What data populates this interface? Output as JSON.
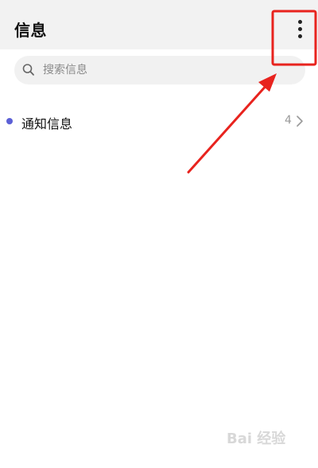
{
  "header": {
    "title": "信息",
    "more_icon": "more-vertical-icon"
  },
  "search": {
    "placeholder": "搜索信息",
    "icon": "search-icon"
  },
  "messages": [
    {
      "label": "通知信息",
      "count": "4",
      "unread": true
    }
  ],
  "annotation": {
    "color": "#e8231e"
  },
  "watermark": {
    "text": "Bai 经验"
  },
  "colors": {
    "header_bg": "#f2f2f2",
    "unread_dot": "#5b60d6",
    "highlight": "#e8231e"
  }
}
